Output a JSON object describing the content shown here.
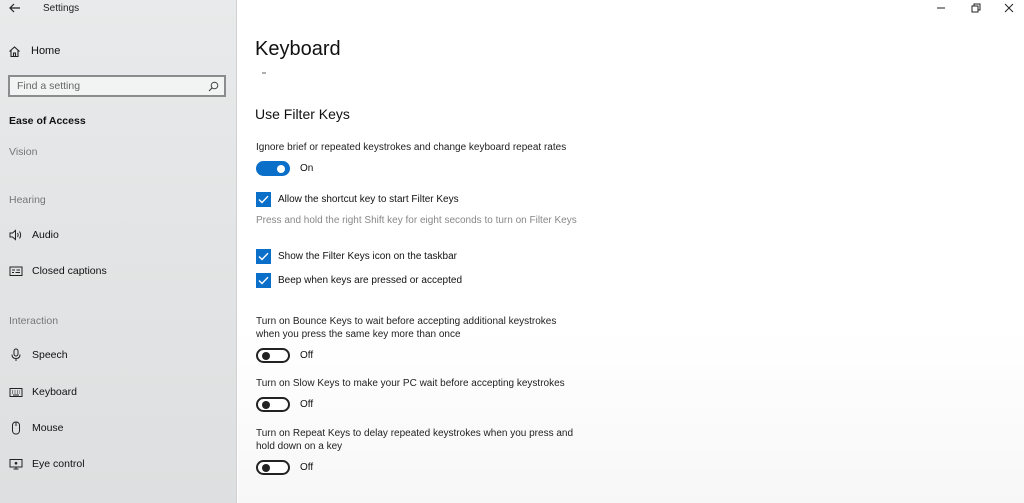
{
  "window": {
    "title": "Settings"
  },
  "sidebar": {
    "home_label": "Home",
    "search": {
      "placeholder": "Find a setting"
    },
    "section_title": "Ease of Access",
    "groups": {
      "vision": "Vision",
      "hearing": "Hearing",
      "interaction": "Interaction"
    },
    "items": [
      {
        "label": "Audio",
        "icon": "speaker-icon"
      },
      {
        "label": "Closed captions",
        "icon": "captions-icon"
      },
      {
        "label": "Speech",
        "icon": "microphone-icon"
      },
      {
        "label": "Keyboard",
        "icon": "keyboard-icon"
      },
      {
        "label": "Mouse",
        "icon": "mouse-icon"
      },
      {
        "label": "Eye control",
        "icon": "eye-control-icon"
      }
    ]
  },
  "main": {
    "page_title": "Keyboard",
    "section_title": "Use Filter Keys",
    "filter_keys": {
      "description": "Ignore brief or repeated keystrokes and change keyboard repeat rates",
      "state": "On"
    },
    "shortcut": {
      "label": "Allow the shortcut key to start Filter Keys",
      "hint": "Press and hold the right Shift key for eight seconds to turn on Filter Keys",
      "checked": true
    },
    "taskbar_icon": {
      "label": "Show the Filter Keys icon on the taskbar",
      "checked": true
    },
    "beep": {
      "label": "Beep when keys are pressed or accepted",
      "checked": true
    },
    "bounce_keys": {
      "line1": "Turn on Bounce Keys to wait before accepting additional keystrokes",
      "line2": "when you press the same key more than once",
      "state": "Off"
    },
    "slow_keys": {
      "line1": "Turn on Slow Keys to make your PC wait before accepting keystrokes",
      "state": "Off"
    },
    "repeat_keys": {
      "line1": "Turn on Repeat Keys to delay repeated keystrokes when you press and",
      "line2": "hold down on a key",
      "state": "Off"
    }
  },
  "colors": {
    "accent": "#0a6fc9",
    "sidebar_bg": "#e5e7e8",
    "content_bg": "#ffffff"
  }
}
